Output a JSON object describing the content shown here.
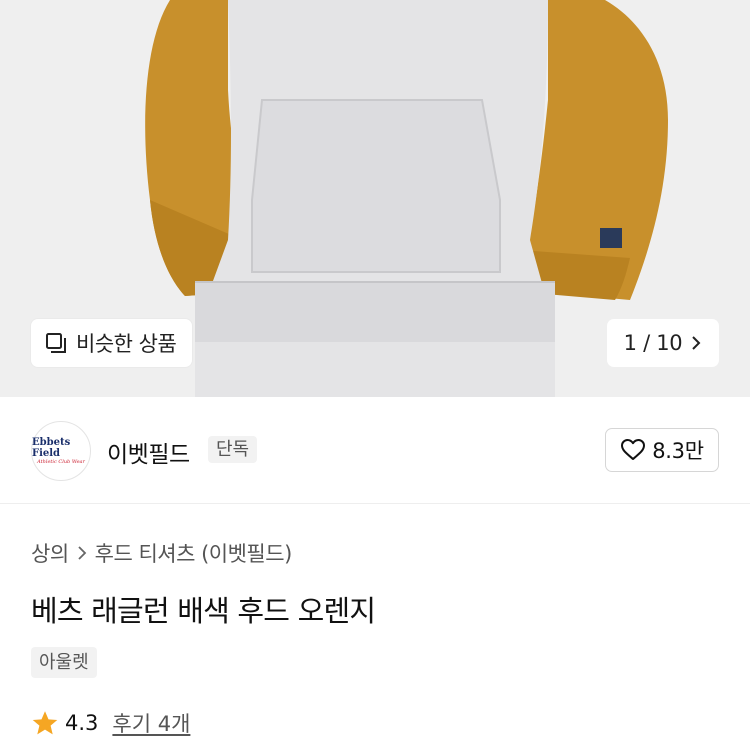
{
  "hero": {
    "similar_label": "비슷한 상품",
    "pager_text": "1 / 10",
    "colors": {
      "body": "#e4e4e6",
      "sleeve": "#c8902c",
      "background": "#efefef"
    }
  },
  "brand": {
    "logo_line1": "Ebbets Field",
    "logo_line2": "Athletic Club Wear",
    "name": "이벳필드",
    "badge": "단독",
    "likes": "8.3만"
  },
  "product": {
    "breadcrumb": [
      "상의",
      "후드 티셔츠 (이벳필드)"
    ],
    "title": "베츠 래글런 배색 후드 오렌지",
    "tag": "아울렛",
    "rating": "4.3",
    "reviews": "후기 4개",
    "star_color": "#f5a623"
  }
}
